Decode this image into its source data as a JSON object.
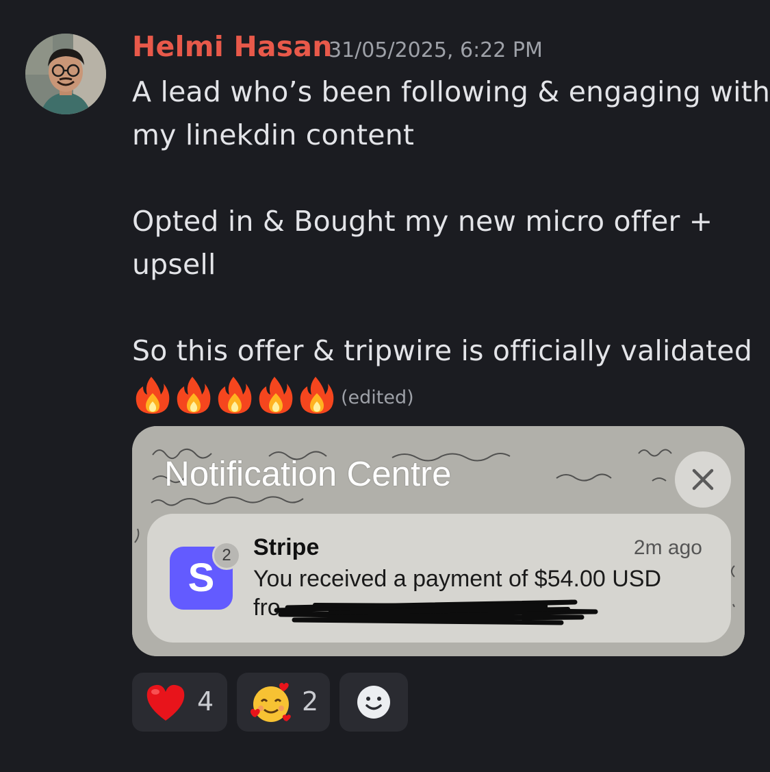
{
  "message": {
    "author": "Helmi Hasan",
    "timestamp": "31/05/2025, 6:22 PM",
    "lines": [
      "A lead who’s been following & engaging with",
      "my linekdin content",
      "Opted in & Bought my new micro offer +",
      "upsell",
      "So this offer & tripwire is officially validated"
    ],
    "emoji_trail": "fire-emoji x5",
    "edited_label": "(edited)"
  },
  "attachment": {
    "panel_title": "Notification Centre",
    "close_icon": "close-icon",
    "notification": {
      "app_name": "Stripe",
      "app_icon_letter": "S",
      "badge_count": "2",
      "time": "2m ago",
      "body": "You received a payment of $54.00 USD",
      "from_prefix": "fro"
    }
  },
  "reactions": [
    {
      "emoji": "red-heart-emoji",
      "count": "4"
    },
    {
      "emoji": "smiling-face-with-hearts-emoji",
      "count": "2"
    },
    {
      "emoji": "add-reaction-icon",
      "count": ""
    }
  ],
  "colors": {
    "background": "#1b1c21",
    "username": "#e8594a",
    "text": "#e3e4e8",
    "muted": "#9ea1a8",
    "stripe_brand": "#635bff",
    "reaction_bg": "#2a2b31"
  }
}
